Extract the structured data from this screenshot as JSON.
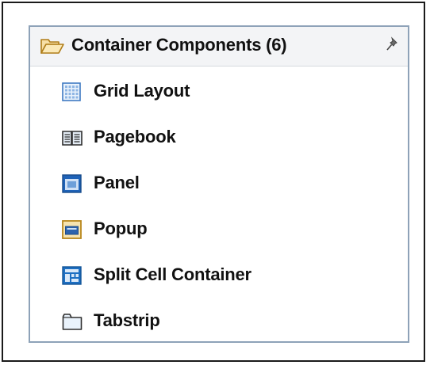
{
  "palette": {
    "title": "Container Components (6)",
    "header_icon": "open-folder-icon",
    "pin_icon": "pin-icon",
    "items": [
      {
        "label": "Grid Layout",
        "icon": "grid-layout-icon"
      },
      {
        "label": "Pagebook",
        "icon": "pagebook-icon"
      },
      {
        "label": "Panel",
        "icon": "panel-icon"
      },
      {
        "label": "Popup",
        "icon": "popup-icon"
      },
      {
        "label": "Split Cell Container",
        "icon": "split-cell-container-icon"
      },
      {
        "label": "Tabstrip",
        "icon": "tabstrip-icon"
      }
    ]
  }
}
